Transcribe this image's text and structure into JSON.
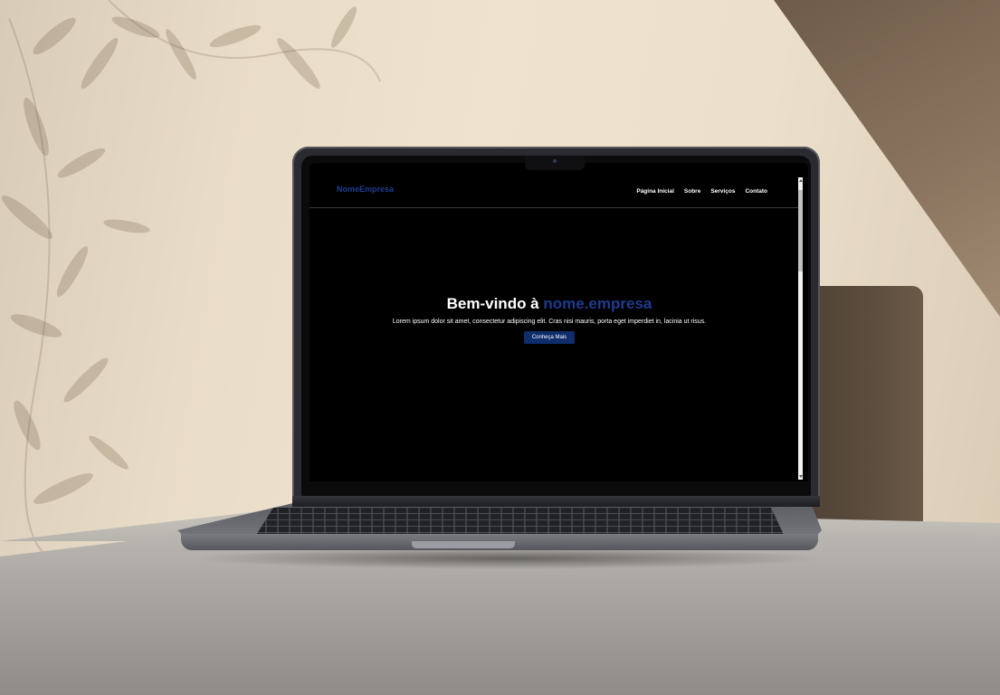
{
  "site": {
    "logo": "NomeEmpresa",
    "nav": [
      {
        "label": "Página Inicial"
      },
      {
        "label": "Sobre"
      },
      {
        "label": "Serviços"
      },
      {
        "label": "Contato"
      }
    ],
    "hero": {
      "title_prefix": "Bem-vindo à ",
      "title_accent": "nome.empresa",
      "text": "Lorem ipsum dolor sit amet, consectetur adipiscing elit. Cras nisi mauris, porta eget imperdiet in, lacinia ut risus.",
      "button_label": "Conheça Mais"
    }
  },
  "colors": {
    "accent": "#1f3b8f",
    "button_bg": "#0f2c6b",
    "page_bg": "#000000",
    "text": "#ffffff"
  }
}
